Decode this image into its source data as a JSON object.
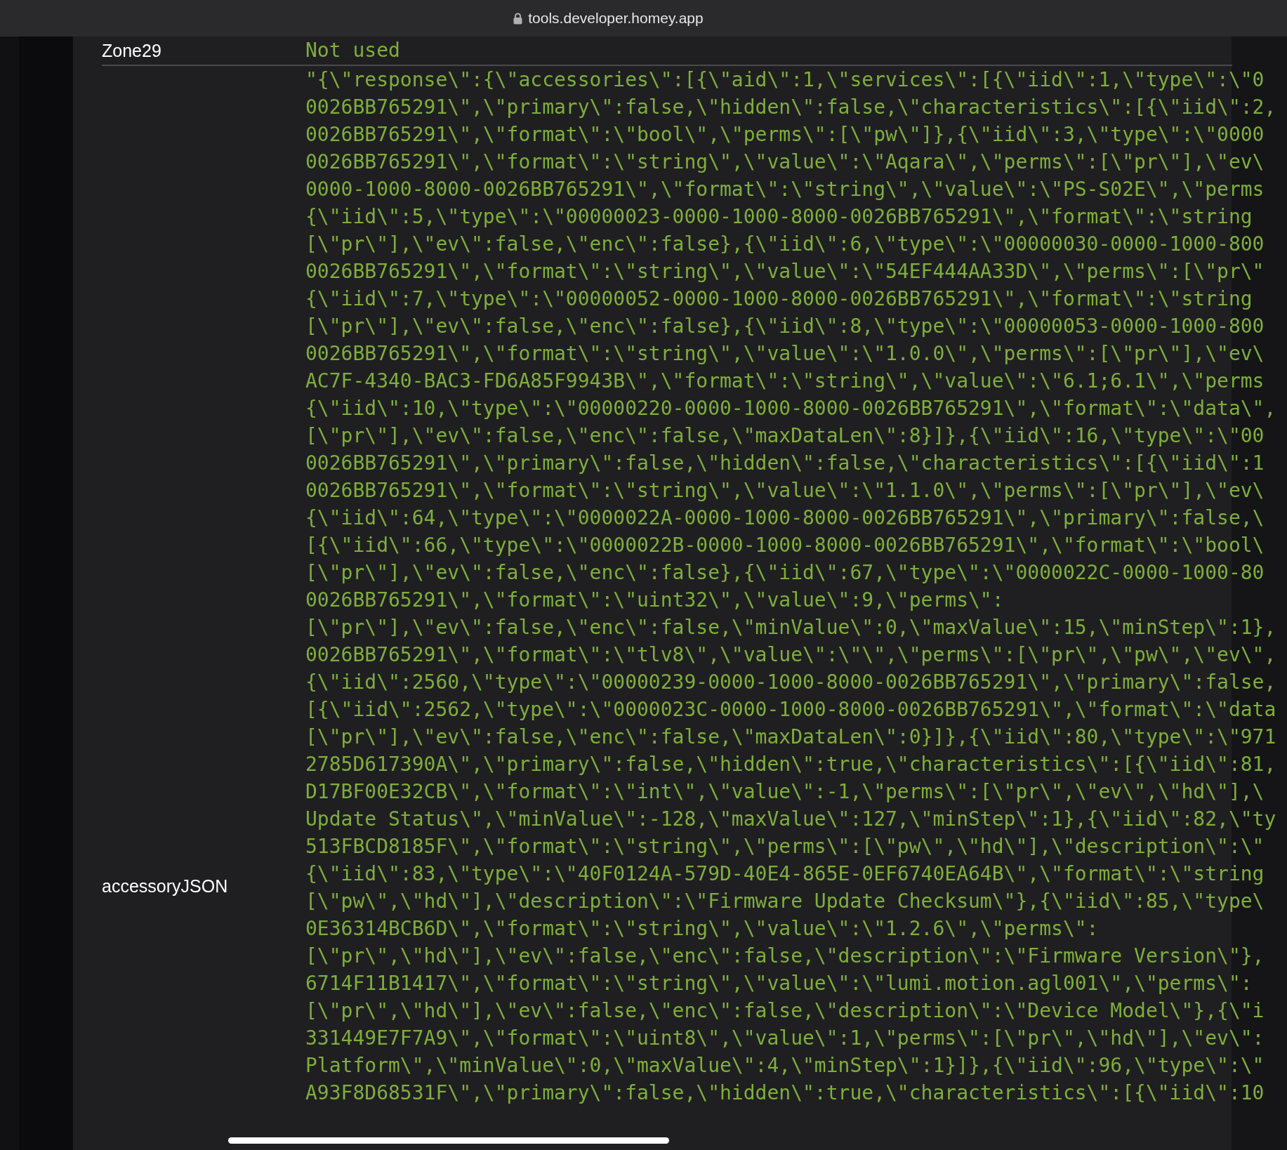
{
  "browser": {
    "url": "tools.developer.homey.app"
  },
  "rows": [
    {
      "label": "Zone29",
      "value_lines": [
        "Not used"
      ]
    },
    {
      "label": "accessoryJSON",
      "value_lines": [
        "\"{\\\"response\\\":{\\\"accessories\\\":[{\\\"aid\\\":1,\\\"services\\\":[{\\\"iid\\\":1,\\\"type\\\":\\\"0",
        "0026BB765291\\\",\\\"primary\\\":false,\\\"hidden\\\":false,\\\"characteristics\\\":[{\\\"iid\\\":2,",
        "0026BB765291\\\",\\\"format\\\":\\\"bool\\\",\\\"perms\\\":[\\\"pw\\\"]},{\\\"iid\\\":3,\\\"type\\\":\\\"0000",
        "0026BB765291\\\",\\\"format\\\":\\\"string\\\",\\\"value\\\":\\\"Aqara\\\",\\\"perms\\\":[\\\"pr\\\"],\\\"ev\\",
        "0000-1000-8000-0026BB765291\\\",\\\"format\\\":\\\"string\\\",\\\"value\\\":\\\"PS-S02E\\\",\\\"perms",
        "{\\\"iid\\\":5,\\\"type\\\":\\\"00000023-0000-1000-8000-0026BB765291\\\",\\\"format\\\":\\\"string",
        "[\\\"pr\\\"],\\\"ev\\\":false,\\\"enc\\\":false},{\\\"iid\\\":6,\\\"type\\\":\\\"00000030-0000-1000-800",
        "0026BB765291\\\",\\\"format\\\":\\\"string\\\",\\\"value\\\":\\\"54EF444AA33D\\\",\\\"perms\\\":[\\\"pr\\\"",
        "{\\\"iid\\\":7,\\\"type\\\":\\\"00000052-0000-1000-8000-0026BB765291\\\",\\\"format\\\":\\\"string",
        "[\\\"pr\\\"],\\\"ev\\\":false,\\\"enc\\\":false},{\\\"iid\\\":8,\\\"type\\\":\\\"00000053-0000-1000-800",
        "0026BB765291\\\",\\\"format\\\":\\\"string\\\",\\\"value\\\":\\\"1.0.0\\\",\\\"perms\\\":[\\\"pr\\\"],\\\"ev\\",
        "AC7F-4340-BAC3-FD6A85F9943B\\\",\\\"format\\\":\\\"string\\\",\\\"value\\\":\\\"6.1;6.1\\\",\\\"perms",
        "{\\\"iid\\\":10,\\\"type\\\":\\\"00000220-0000-1000-8000-0026BB765291\\\",\\\"format\\\":\\\"data\\\",",
        "[\\\"pr\\\"],\\\"ev\\\":false,\\\"enc\\\":false,\\\"maxDataLen\\\":8}]},{\\\"iid\\\":16,\\\"type\\\":\\\"00",
        "0026BB765291\\\",\\\"primary\\\":false,\\\"hidden\\\":false,\\\"characteristics\\\":[{\\\"iid\\\":1",
        "0026BB765291\\\",\\\"format\\\":\\\"string\\\",\\\"value\\\":\\\"1.1.0\\\",\\\"perms\\\":[\\\"pr\\\"],\\\"ev\\",
        "{\\\"iid\\\":64,\\\"type\\\":\\\"0000022A-0000-1000-8000-0026BB765291\\\",\\\"primary\\\":false,\\",
        "[{\\\"iid\\\":66,\\\"type\\\":\\\"0000022B-0000-1000-8000-0026BB765291\\\",\\\"format\\\":\\\"bool\\",
        "[\\\"pr\\\"],\\\"ev\\\":false,\\\"enc\\\":false},{\\\"iid\\\":67,\\\"type\\\":\\\"0000022C-0000-1000-80",
        "0026BB765291\\\",\\\"format\\\":\\\"uint32\\\",\\\"value\\\":9,\\\"perms\\\":",
        "[\\\"pr\\\"],\\\"ev\\\":false,\\\"enc\\\":false,\\\"minValue\\\":0,\\\"maxValue\\\":15,\\\"minStep\\\":1},",
        "0026BB765291\\\",\\\"format\\\":\\\"tlv8\\\",\\\"value\\\":\\\"\\\",\\\"perms\\\":[\\\"pr\\\",\\\"pw\\\",\\\"ev\\\",",
        "{\\\"iid\\\":2560,\\\"type\\\":\\\"00000239-0000-1000-8000-0026BB765291\\\",\\\"primary\\\":false,",
        "[{\\\"iid\\\":2562,\\\"type\\\":\\\"0000023C-0000-1000-8000-0026BB765291\\\",\\\"format\\\":\\\"data",
        "[\\\"pr\\\"],\\\"ev\\\":false,\\\"enc\\\":false,\\\"maxDataLen\\\":0}]},{\\\"iid\\\":80,\\\"type\\\":\\\"971",
        "2785D617390A\\\",\\\"primary\\\":false,\\\"hidden\\\":true,\\\"characteristics\\\":[{\\\"iid\\\":81,",
        "D17BF00E32CB\\\",\\\"format\\\":\\\"int\\\",\\\"value\\\":-1,\\\"perms\\\":[\\\"pr\\\",\\\"ev\\\",\\\"hd\\\"],\\",
        "Update Status\\\",\\\"minValue\\\":-128,\\\"maxValue\\\":127,\\\"minStep\\\":1},{\\\"iid\\\":82,\\\"ty",
        "513FBCD8185F\\\",\\\"format\\\":\\\"string\\\",\\\"perms\\\":[\\\"pw\\\",\\\"hd\\\"],\\\"description\\\":\\\"",
        "{\\\"iid\\\":83,\\\"type\\\":\\\"40F0124A-579D-40E4-865E-0EF6740EA64B\\\",\\\"format\\\":\\\"string",
        "[\\\"pw\\\",\\\"hd\\\"],\\\"description\\\":\\\"Firmware Update Checksum\\\"},{\\\"iid\\\":85,\\\"type\\",
        "0E36314BCB6D\\\",\\\"format\\\":\\\"string\\\",\\\"value\\\":\\\"1.2.6\\\",\\\"perms\\\":",
        "[\\\"pr\\\",\\\"hd\\\"],\\\"ev\\\":false,\\\"enc\\\":false,\\\"description\\\":\\\"Firmware Version\\\"},",
        "6714F11B1417\\\",\\\"format\\\":\\\"string\\\",\\\"value\\\":\\\"lumi.motion.agl001\\\",\\\"perms\\\":",
        "[\\\"pr\\\",\\\"hd\\\"],\\\"ev\\\":false,\\\"enc\\\":false,\\\"description\\\":\\\"Device Model\\\"},{\\\"i",
        "331449E7F7A9\\\",\\\"format\\\":\\\"uint8\\\",\\\"value\\\":1,\\\"perms\\\":[\\\"pr\\\",\\\"hd\\\"],\\\"ev\\\":",
        "Platform\\\",\\\"minValue\\\":0,\\\"maxValue\\\":4,\\\"minStep\\\":1}]},{\\\"iid\\\":96,\\\"type\\\":\\\"",
        "A93F8D68531F\\\",\\\"primary\\\":false,\\\"hidden\\\":true,\\\"characteristics\\\":[{\\\"iid\\\":10"
      ]
    }
  ]
}
